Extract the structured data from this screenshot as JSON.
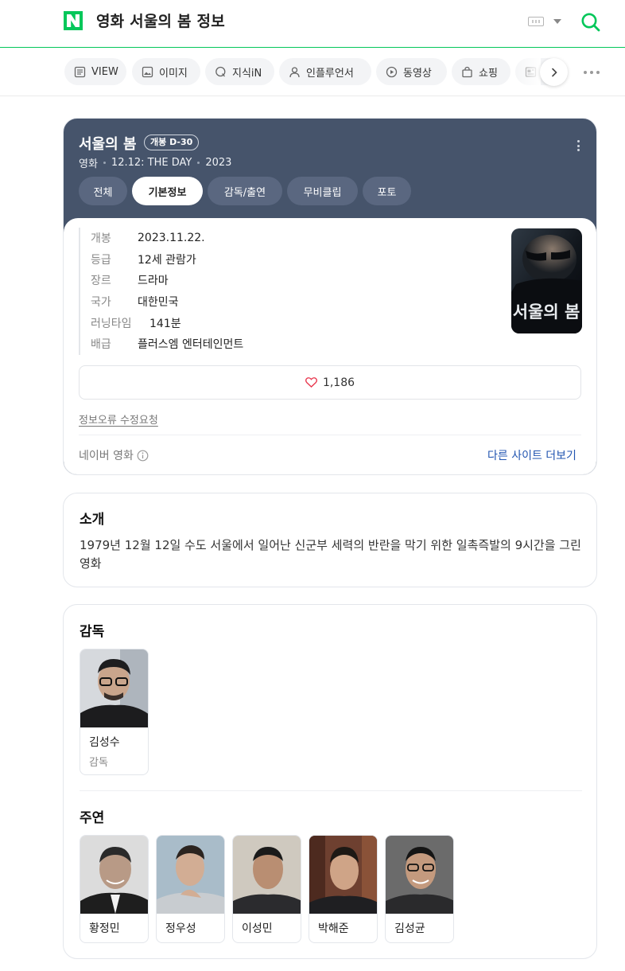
{
  "header": {
    "query": "영화 서울의 봄 정보"
  },
  "tabs": [
    {
      "label": "VIEW",
      "icon": "document-icon"
    },
    {
      "label": "이미지",
      "icon": "image-icon"
    },
    {
      "label": "지식iN",
      "icon": "speech-q-icon"
    },
    {
      "label": "인플루언서",
      "icon": "person-icon"
    },
    {
      "label": "동영상",
      "icon": "play-icon"
    },
    {
      "label": "쇼핑",
      "icon": "bag-icon"
    }
  ],
  "movie": {
    "title": "서울의 봄",
    "dday_badge": "개봉 D-30",
    "meta": [
      "영화",
      "12.12: THE DAY",
      "2023"
    ],
    "subtabs": [
      "전체",
      "기본정보",
      "감독/출연",
      "무비클립",
      "포토"
    ],
    "active_subtab": "기본정보",
    "poster_title": "서울의 봄",
    "info": [
      {
        "key": "개봉",
        "value": "2023.11.22."
      },
      {
        "key": "등급",
        "value": "12세 관람가"
      },
      {
        "key": "장르",
        "value": "드라마"
      },
      {
        "key": "국가",
        "value": "대한민국"
      },
      {
        "key": "러닝타임",
        "value": "141분"
      },
      {
        "key": "배급",
        "value": "플러스엠 엔터테인먼트"
      }
    ],
    "likes": "1,186",
    "report_link": "정보오류 수정요청",
    "source": "네이버 영화",
    "more_sites": "다른 사이트 더보기"
  },
  "intro": {
    "title": "소개",
    "text": "1979년 12월 12일 수도 서울에서 일어난 신군부 세력의 반란을 막기 위한 일촉즉발의 9시간을 그린 영화"
  },
  "crew": {
    "director_title": "감독",
    "directors": [
      {
        "name": "김성수",
        "role": "감독"
      }
    ],
    "cast_title": "주연",
    "cast": [
      {
        "name": "황정민"
      },
      {
        "name": "정우성"
      },
      {
        "name": "이성민"
      },
      {
        "name": "박해준"
      },
      {
        "name": "김성균"
      }
    ]
  },
  "colors": {
    "brand_green": "#03c75a",
    "card_header": "#46546b",
    "link_blue": "#2154b0",
    "heart_red": "#e8384f"
  }
}
